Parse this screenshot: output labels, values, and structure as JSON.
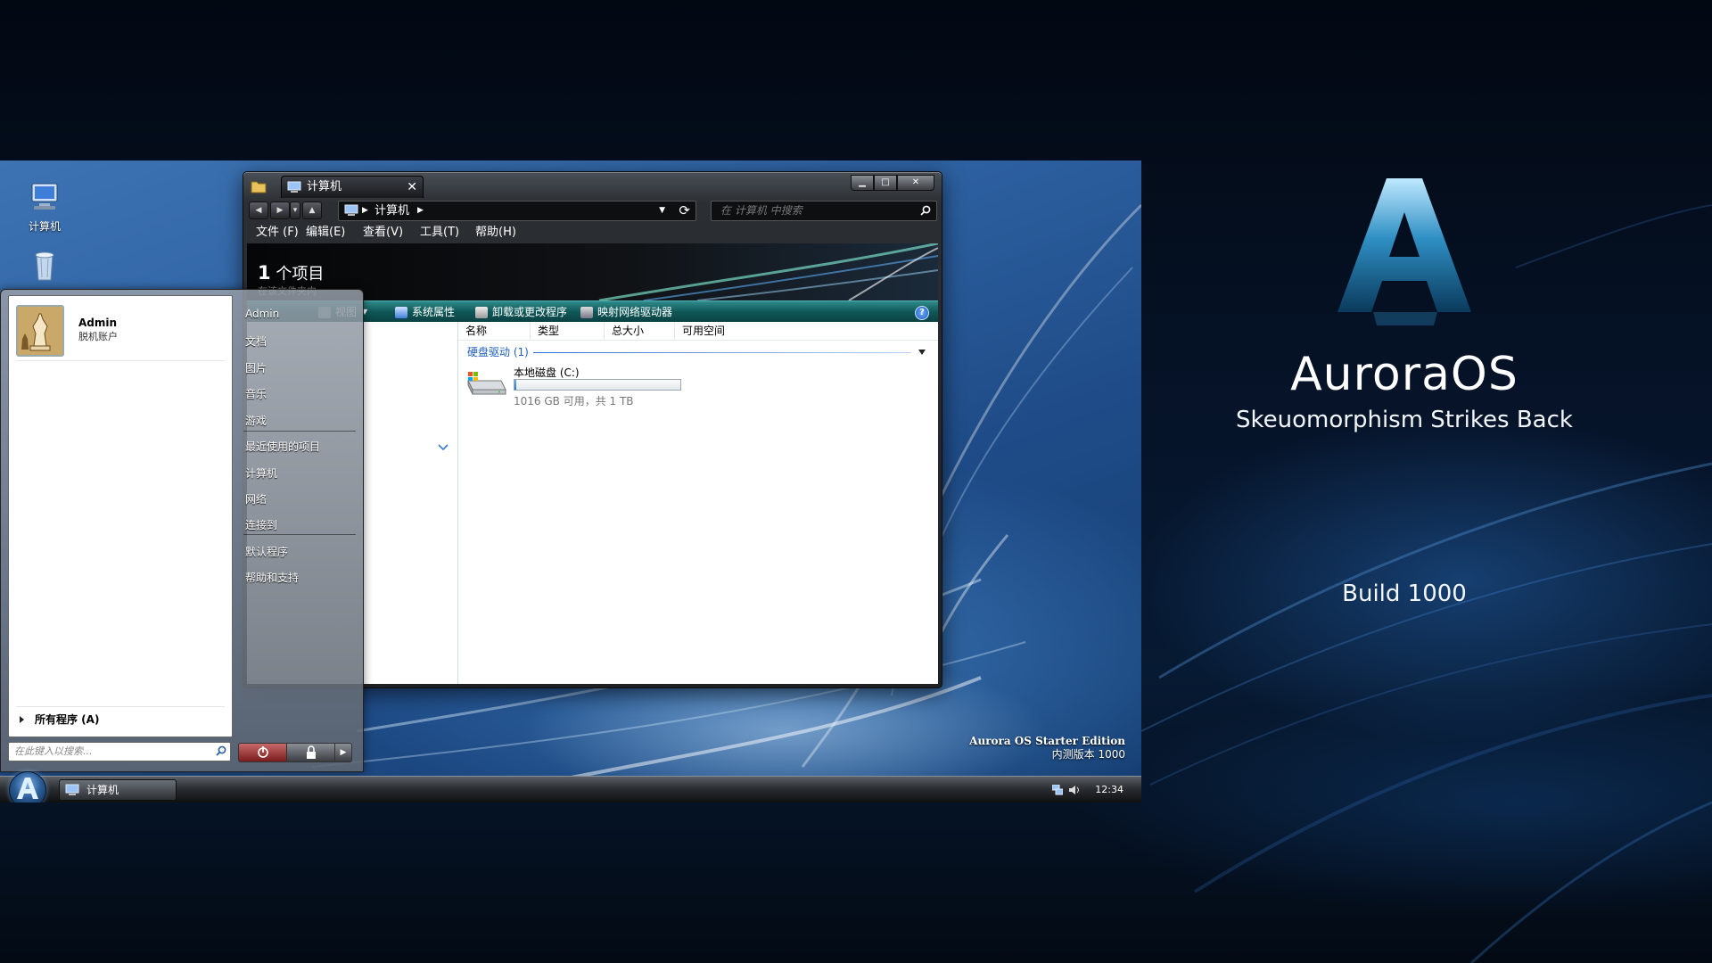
{
  "brand": {
    "name": "AuroraOS",
    "tagline": "Skeuomorphism Strikes Back",
    "build": "Build 1000"
  },
  "desktop": {
    "icons": [
      {
        "label": "计算机",
        "icon": "computer-icon"
      },
      {
        "label": "",
        "icon": "recycle-bin-icon"
      }
    ],
    "edition_name": "Aurora OS Starter Edition",
    "edition_build": "内测版本 1000"
  },
  "explorer": {
    "tab_label": "计算机",
    "address": "计算机",
    "search_placeholder": "在 计算机 中搜索",
    "menu": [
      "文件 (F)",
      "编辑(E)",
      "查看(V)",
      "工具(T)",
      "帮助(H)"
    ],
    "banner_count": "1",
    "banner_count_suffix": "个项目",
    "banner_sub": "在该文件夹内",
    "commands": [
      "视图",
      "系统属性",
      "卸载或更改程序",
      "映射网络驱动器"
    ],
    "columns": [
      "名称",
      "类型",
      "总大小",
      "可用空间"
    ],
    "group_label": "硬盘驱动 (1)",
    "drive": {
      "name": "本地磁盘 (C:)",
      "info": "1016 GB 可用，共 1 TB",
      "used_fraction": 0.01
    }
  },
  "startmenu": {
    "user_name": "Admin",
    "user_type": "脱机账户",
    "right_items": [
      "Admin",
      "文档",
      "图片",
      "音乐",
      "游戏",
      "最近使用的项目",
      "计算机",
      "网络",
      "连接到",
      "默认程序",
      "帮助和支持"
    ],
    "all_programs": "所有程序 (A)",
    "search_placeholder": "在此键入以搜索..."
  },
  "taskbar": {
    "task_label": "计算机",
    "clock": "12:34"
  },
  "colors": {
    "command_bar": "#0f5757",
    "desktop_blue": "#2c5f9f",
    "group_link": "#1e5ebc"
  }
}
